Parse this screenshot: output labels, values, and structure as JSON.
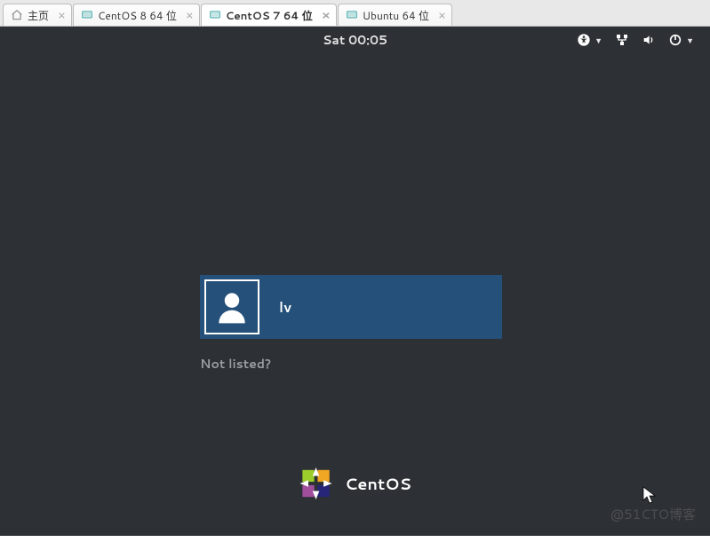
{
  "tabs": [
    {
      "label": "主页",
      "type": "home"
    },
    {
      "label": "CentOS 8 64 位",
      "type": "vm"
    },
    {
      "label": "CentOS 7 64 位",
      "type": "vm",
      "active": true
    },
    {
      "label": "Ubuntu 64 位",
      "type": "vm"
    }
  ],
  "top_panel": {
    "clock": "Sat 00:05"
  },
  "login": {
    "username": "lv",
    "not_listed": "Not listed?"
  },
  "branding": {
    "product": "CentOS"
  },
  "watermark": "@51CTO博客"
}
